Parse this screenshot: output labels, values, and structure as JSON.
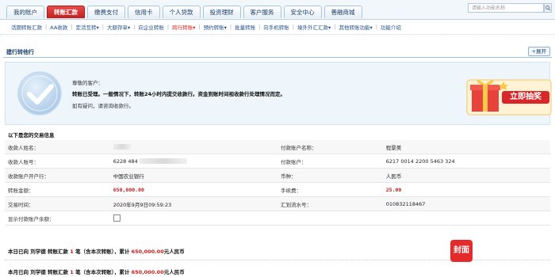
{
  "top_tabs": [
    {
      "label": "我的账户"
    },
    {
      "label": "转账汇款"
    },
    {
      "label": "缴费支付"
    },
    {
      "label": "信用卡"
    },
    {
      "label": "个人贷款"
    },
    {
      "label": "投资理财"
    },
    {
      "label": "客户服务"
    },
    {
      "label": "安全中心"
    },
    {
      "label": "善融商城"
    }
  ],
  "active_tab_index": 1,
  "search": {
    "placeholder": "请输入功能名称"
  },
  "subnav": [
    {
      "label": "活期转账汇款"
    },
    {
      "label": "AA收款"
    },
    {
      "label": "定活互转▾"
    },
    {
      "label": "大额存单▾"
    },
    {
      "label": "向企业转账"
    },
    {
      "label": "跨行转账▾"
    },
    {
      "label": "预约转账▾"
    },
    {
      "label": "批量转账"
    },
    {
      "label": "向手机转账"
    },
    {
      "label": "境外外汇汇款▾"
    },
    {
      "label": "其他转账功能▾"
    },
    {
      "label": "功能介绍"
    }
  ],
  "section": {
    "title": "建行转他行",
    "expand_label": "+展开"
  },
  "notice": {
    "greeting": "尊敬的客户：",
    "main": "转账已受理。一般情况下，转账24小时内提交收款行。资金到账时间视收款行处理情况而定。",
    "help": "如有疑问，请咨询收款行。"
  },
  "lottery": {
    "label": "立即抽奖"
  },
  "info": {
    "title": "以下是您的交易信息",
    "rows": [
      {
        "l1": "收款人姓名：",
        "v1": "",
        "l2": "付款账户名称：",
        "v2": "程景美"
      },
      {
        "l1": "收款人账号：",
        "v1": "6228 484",
        "l2": "付款账户：",
        "v2": "6217 0014 2200 5463 324"
      },
      {
        "l1": "收款账户开户行：",
        "v1": "中国农业银行",
        "l2": "币种：",
        "v2": "人民币"
      },
      {
        "l1": "转账金额：",
        "v1": "650,000.00",
        "l2": "手续费：",
        "v2": "25.00"
      },
      {
        "l1": "交易时间：",
        "v1": "2020年9月9日09:59:23",
        "l2": "汇划流水号：",
        "v2": "010832118467"
      },
      {
        "l1": "显示付款账户余额：",
        "v1": "",
        "l2": "",
        "v2": ""
      }
    ]
  },
  "summary_day": {
    "prefix": "本日已向 刘学德 转账汇款",
    "count": "1",
    "mid": "笔（含本次转账），累计",
    "amount": "650,000.00",
    "suffix": "元人民币"
  },
  "summary_month": {
    "prefix": "本月已向 刘学德 转账汇款",
    "count": "1",
    "mid": "笔（含本次转账），累计",
    "amount": "650,000.00",
    "suffix": "元人民币"
  },
  "watermark_logo": "封面",
  "colors": {
    "active_tab": "#c41e1e",
    "accent_blue": "#1a3f6b",
    "amount_red": "#c71d1d"
  }
}
